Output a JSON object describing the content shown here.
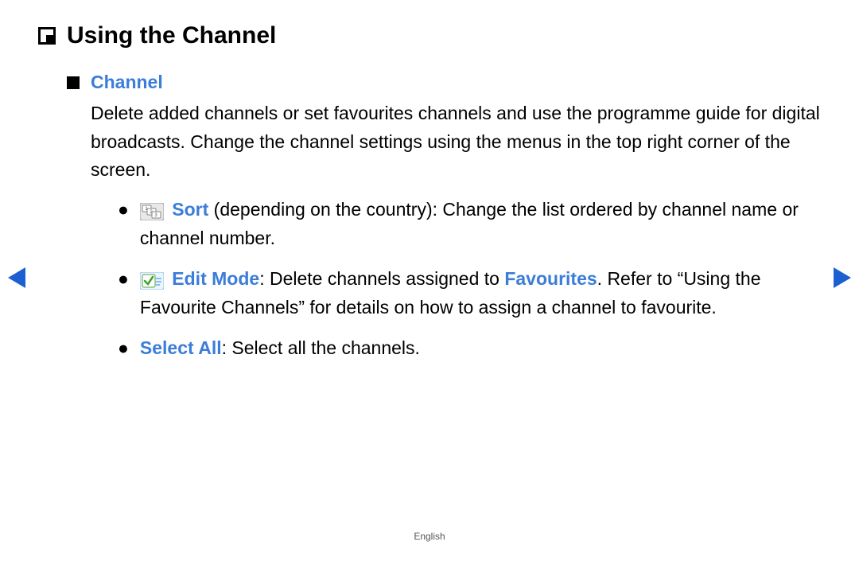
{
  "title": "Using the Channel",
  "section": {
    "heading": "Channel",
    "body": "Delete added channels or set favourites channels and use the programme guide for digital broadcasts. Change the channel settings using the menus in the top right corner of the screen."
  },
  "items": [
    {
      "icon": "sort-icon",
      "term": "Sort",
      "aside": " (depending on the country)",
      "desc": ": Change the list ordered by channel name or channel number."
    },
    {
      "icon": "editmode-icon",
      "term": "Edit Mode",
      "desc_pre": ": Delete channels assigned to ",
      "term2": "Favourites",
      "desc_post": ". Refer to “Using the Favourite Channels” for details on how to assign a channel to favourite."
    },
    {
      "term": "Select All",
      "desc": ": Select all the channels."
    }
  ],
  "footer": {
    "language": "English"
  }
}
